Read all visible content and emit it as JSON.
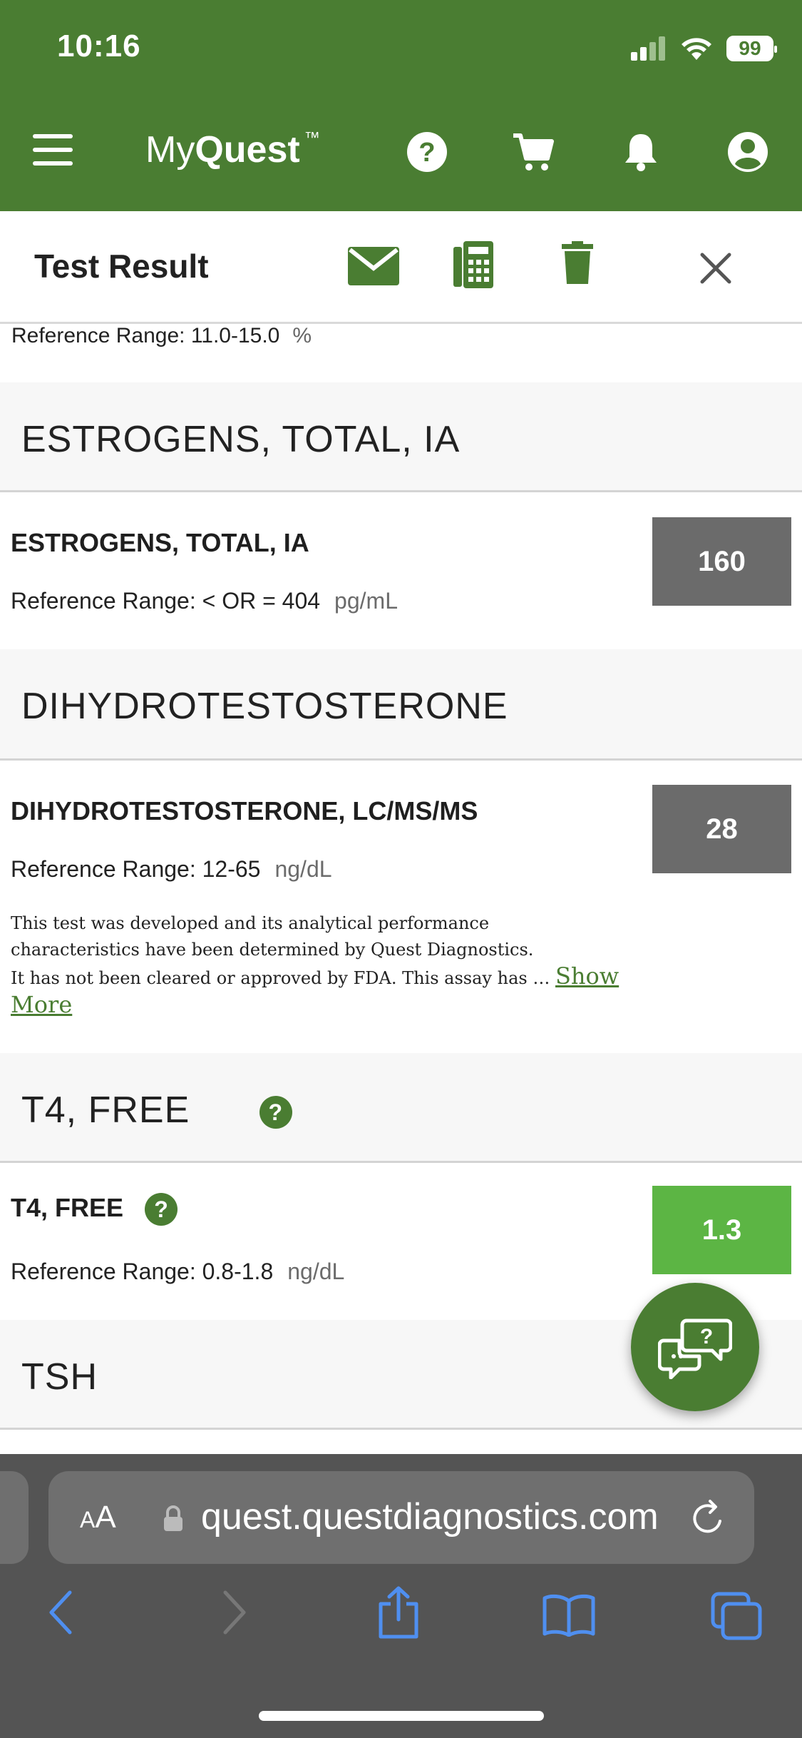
{
  "status_bar": {
    "time": "10:16",
    "battery": "99"
  },
  "nav": {
    "logo_my": "My",
    "logo_quest": "Quest",
    "logo_tm": "™"
  },
  "header": {
    "title": "Test Result"
  },
  "partial": {
    "ref_label": "Reference Range: 11.0-15.0",
    "unit": "%"
  },
  "sections": [
    {
      "title": "ESTROGENS, TOTAL, IA",
      "test": {
        "name": "ESTROGENS, TOTAL, IA",
        "reference": "Reference Range: < OR = 404",
        "unit": "pg/mL",
        "value": "160",
        "status": "normal-gray"
      }
    },
    {
      "title": "DIHYDROTESTOSTERONE",
      "test": {
        "name": "DIHYDROTESTOSTERONE, LC/MS/MS",
        "reference": "Reference Range: 12-65",
        "unit": "ng/dL",
        "value": "28",
        "status": "normal-gray"
      },
      "note": {
        "line1": "This test was developed and its analytical performance",
        "line2": "characteristics have been determined by Quest Diagnostics.",
        "line3": "It has not been cleared or approved by FDA. This assay has",
        "ellipsis": "…",
        "show_more": "Show More"
      }
    },
    {
      "title": "T4, FREE",
      "help": "?",
      "test": {
        "name": "T4, FREE",
        "help": "?",
        "reference": "Reference Range: 0.8-1.8",
        "unit": "ng/dL",
        "value": "1.3",
        "status": "in-range-green"
      }
    },
    {
      "title": "TSH"
    }
  ],
  "chat": {
    "icon": "chat-help-icon",
    "mark": "?"
  },
  "browser": {
    "aa_small": "A",
    "aa_large": "A",
    "url": "quest.questdiagnostics.com"
  },
  "colors": {
    "brand_green": "#4a7d32",
    "in_range_green": "#5cb544",
    "neutral_gray": "#6b6b6b",
    "safari_bar": "#545454"
  }
}
